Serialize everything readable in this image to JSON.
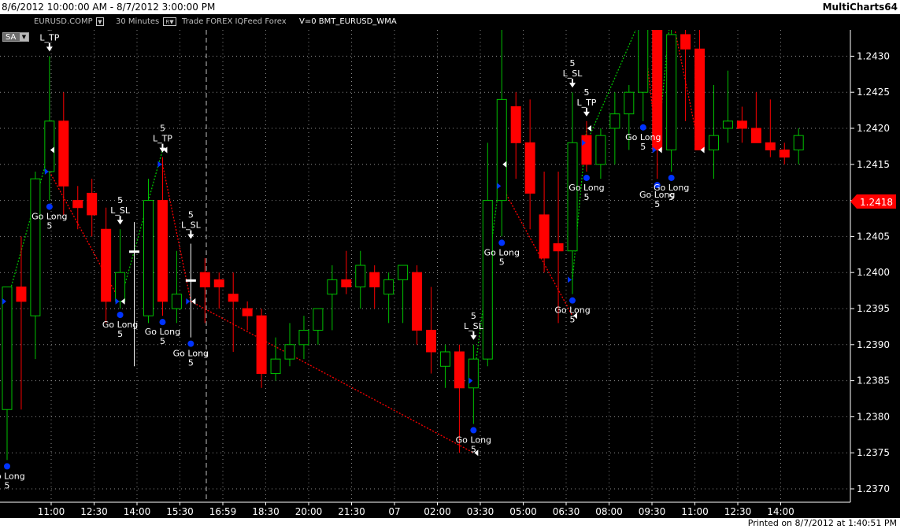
{
  "window": {
    "date_range": "8/6/2012 10:00:00 AM - 8/7/2012 3:00:00 PM",
    "app_name": "MultiCharts64"
  },
  "infobar": {
    "sa_label": "SA",
    "symbol": "EURUSD.COMP",
    "resolution": "30 Minutes",
    "data_label": "Trade FOREX IQFeed Forex",
    "study": "V=0  BMT_EURUSD_WMA"
  },
  "footer": {
    "printed": "Printed on 8/7/2012 at 1:40:51 PM"
  },
  "colors": {
    "up_candle": "#00c000",
    "down_candle": "#ff0000",
    "doji_candle": "#ffffff",
    "current_price_badge": "#ff0000",
    "long_trade_line": "#00c000",
    "exit_trade_line": "#ff0000",
    "entry_marker": "#0033ff"
  },
  "chart_data": {
    "type": "candlestick",
    "x_tick_labels": [
      "11:00",
      "12:30",
      "14:00",
      "15:30",
      "16:59",
      "18:30",
      "20:00",
      "21:30",
      "07",
      "02:00",
      "03:30",
      "05:00",
      "06:30",
      "08:00",
      "09:30",
      "11:00",
      "12:30",
      "14:00"
    ],
    "y_tick_labels": [
      "1.2440",
      "1.2435",
      "1.2430",
      "1.2425",
      "1.2420",
      "1.2415",
      "1.2410",
      "1.2405",
      "1.2400",
      "1.2395",
      "1.2390",
      "1.2385",
      "1.2380",
      "1.2375",
      "1.2370"
    ],
    "ylim": [
      1.2368,
      1.245
    ],
    "last_price": "1.2418",
    "bars": [
      {
        "open": 1.2381,
        "high": 1.2397,
        "low": 1.2374,
        "close": 1.2398
      },
      {
        "open": 1.2398,
        "high": 1.2405,
        "low": 1.2381,
        "close": 1.2396
      },
      {
        "open": 1.2394,
        "high": 1.2414,
        "low": 1.2388,
        "close": 1.2413
      },
      {
        "open": 1.2414,
        "high": 1.243,
        "low": 1.241,
        "close": 1.2421
      },
      {
        "open": 1.2421,
        "high": 1.2425,
        "low": 1.2408,
        "close": 1.2412
      },
      {
        "open": 1.241,
        "high": 1.2412,
        "low": 1.2406,
        "close": 1.2409
      },
      {
        "open": 1.2411,
        "high": 1.2413,
        "low": 1.2405,
        "close": 1.2408
      },
      {
        "open": 1.2406,
        "high": 1.2409,
        "low": 1.2393,
        "close": 1.2396
      },
      {
        "open": 1.2396,
        "high": 1.2406,
        "low": 1.2395,
        "close": 1.24
      },
      {
        "open": 1.2403,
        "high": 1.2407,
        "low": 1.2387,
        "close": 1.2403
      },
      {
        "open": 1.2394,
        "high": 1.2413,
        "low": 1.2393,
        "close": 1.241
      },
      {
        "open": 1.241,
        "high": 1.2416,
        "low": 1.2394,
        "close": 1.2396
      },
      {
        "open": 1.2395,
        "high": 1.2403,
        "low": 1.2393,
        "close": 1.2397
      },
      {
        "open": 1.2399,
        "high": 1.2404,
        "low": 1.2391,
        "close": 1.2399
      },
      {
        "open": 1.24,
        "high": 1.2402,
        "low": 1.2393,
        "close": 1.2398
      },
      {
        "open": 1.2399,
        "high": 1.24,
        "low": 1.2395,
        "close": 1.2398
      },
      {
        "open": 1.2397,
        "high": 1.24,
        "low": 1.2389,
        "close": 1.2396
      },
      {
        "open": 1.2395,
        "high": 1.2396,
        "low": 1.2392,
        "close": 1.2394
      },
      {
        "open": 1.2394,
        "high": 1.2395,
        "low": 1.2384,
        "close": 1.2386
      },
      {
        "open": 1.2386,
        "high": 1.2391,
        "low": 1.2385,
        "close": 1.2388
      },
      {
        "open": 1.2388,
        "high": 1.2393,
        "low": 1.2387,
        "close": 1.239
      },
      {
        "open": 1.239,
        "high": 1.2394,
        "low": 1.2388,
        "close": 1.2392
      },
      {
        "open": 1.2392,
        "high": 1.2395,
        "low": 1.239,
        "close": 1.2395
      },
      {
        "open": 1.2397,
        "high": 1.2401,
        "low": 1.2392,
        "close": 1.2399
      },
      {
        "open": 1.2399,
        "high": 1.2403,
        "low": 1.2397,
        "close": 1.2398
      },
      {
        "open": 1.2398,
        "high": 1.2403,
        "low": 1.2395,
        "close": 1.2401
      },
      {
        "open": 1.24,
        "high": 1.2401,
        "low": 1.2395,
        "close": 1.2398
      },
      {
        "open": 1.2397,
        "high": 1.24,
        "low": 1.2393,
        "close": 1.2399
      },
      {
        "open": 1.2399,
        "high": 1.2401,
        "low": 1.2393,
        "close": 1.2401
      },
      {
        "open": 1.24,
        "high": 1.2401,
        "low": 1.239,
        "close": 1.2392
      },
      {
        "open": 1.2392,
        "high": 1.2398,
        "low": 1.2386,
        "close": 1.2389
      },
      {
        "open": 1.2387,
        "high": 1.239,
        "low": 1.2384,
        "close": 1.2389
      },
      {
        "open": 1.2389,
        "high": 1.239,
        "low": 1.2375,
        "close": 1.2384
      },
      {
        "open": 1.2384,
        "high": 1.239,
        "low": 1.2379,
        "close": 1.2388
      },
      {
        "open": 1.2388,
        "high": 1.2418,
        "low": 1.2387,
        "close": 1.241
      },
      {
        "open": 1.241,
        "high": 1.2434,
        "low": 1.2405,
        "close": 1.2424
      },
      {
        "open": 1.2423,
        "high": 1.2425,
        "low": 1.2413,
        "close": 1.2418
      },
      {
        "open": 1.2418,
        "high": 1.2424,
        "low": 1.2406,
        "close": 1.2411
      },
      {
        "open": 1.2408,
        "high": 1.2414,
        "low": 1.24,
        "close": 1.2402
      },
      {
        "open": 1.2404,
        "high": 1.2414,
        "low": 1.2393,
        "close": 1.2403
      },
      {
        "open": 1.2403,
        "high": 1.2425,
        "low": 1.2397,
        "close": 1.2418
      },
      {
        "open": 1.2419,
        "high": 1.2421,
        "low": 1.2414,
        "close": 1.2415
      },
      {
        "open": 1.2415,
        "high": 1.242,
        "low": 1.2413,
        "close": 1.2419
      },
      {
        "open": 1.242,
        "high": 1.2425,
        "low": 1.2415,
        "close": 1.2422
      },
      {
        "open": 1.2422,
        "high": 1.2426,
        "low": 1.2417,
        "close": 1.2425
      },
      {
        "open": 1.2425,
        "high": 1.2441,
        "low": 1.2421,
        "close": 1.2436
      },
      {
        "open": 1.2434,
        "high": 1.244,
        "low": 1.2413,
        "close": 1.2417
      },
      {
        "open": 1.2417,
        "high": 1.2437,
        "low": 1.2414,
        "close": 1.2433
      },
      {
        "open": 1.2433,
        "high": 1.2437,
        "low": 1.2421,
        "close": 1.2431
      },
      {
        "open": 1.2431,
        "high": 1.244,
        "low": 1.2417,
        "close": 1.2417
      },
      {
        "open": 1.2417,
        "high": 1.2426,
        "low": 1.2413,
        "close": 1.2419
      },
      {
        "open": 1.242,
        "high": 1.2428,
        "low": 1.2418,
        "close": 1.2421
      },
      {
        "open": 1.2421,
        "high": 1.2423,
        "low": 1.2418,
        "close": 1.242
      },
      {
        "open": 1.242,
        "high": 1.2425,
        "low": 1.2418,
        "close": 1.2418
      },
      {
        "open": 1.2418,
        "high": 1.2424,
        "low": 1.2416,
        "close": 1.2417
      },
      {
        "open": 1.2417,
        "high": 1.2418,
        "low": 1.2415,
        "close": 1.2416
      },
      {
        "open": 1.2417,
        "high": 1.242,
        "low": 1.2415,
        "close": 1.2419
      }
    ],
    "trades": [
      {
        "entry_bar": 0,
        "entry_price": 1.2396,
        "exit_bar": 3,
        "exit_price": 1.2417,
        "exit_label": "L_TP"
      },
      {
        "entry_bar": 3,
        "entry_price": 1.2414,
        "exit_bar": 8,
        "exit_price": 1.2396,
        "exit_label": "L_SL"
      },
      {
        "entry_bar": 8,
        "entry_price": 1.2396,
        "exit_bar": 11,
        "exit_price": 1.2417,
        "exit_label": "L_TP"
      },
      {
        "entry_bar": 11,
        "entry_price": 1.2415,
        "exit_bar": 13,
        "exit_price": 1.2396,
        "exit_label": "L_SL"
      },
      {
        "entry_bar": 13,
        "entry_price": 1.2396,
        "exit_bar": 33,
        "exit_price": 1.2375,
        "exit_label": "L_SL"
      },
      {
        "entry_bar": 33,
        "entry_price": 1.2385,
        "exit_bar": 35,
        "exit_price": 1.2415,
        "exit_label": "L_TP"
      },
      {
        "entry_bar": 35,
        "entry_price": 1.2412,
        "exit_bar": 40,
        "exit_price": 1.2394,
        "exit_label": "L_SL"
      },
      {
        "entry_bar": 40,
        "entry_price": 1.2399,
        "exit_bar": 41,
        "exit_price": 1.242,
        "exit_label": "L_TP"
      },
      {
        "entry_bar": 41,
        "entry_price": 1.2418,
        "exit_bar": 45,
        "exit_price": 1.2436,
        "exit_label": "L_TP"
      },
      {
        "entry_bar": 45,
        "entry_price": 1.2434,
        "exit_bar": 46,
        "exit_price": 1.2417,
        "exit_label": "L_SL"
      },
      {
        "entry_bar": 46,
        "entry_price": 1.2417,
        "exit_bar": 47,
        "exit_price": 1.2437,
        "exit_label": "L_TP"
      },
      {
        "entry_bar": 47,
        "entry_price": 1.2436,
        "exit_bar": 49,
        "exit_price": 1.2417,
        "exit_label": "L_SL"
      }
    ],
    "entry_label": "Go Long",
    "size_label": "5"
  }
}
